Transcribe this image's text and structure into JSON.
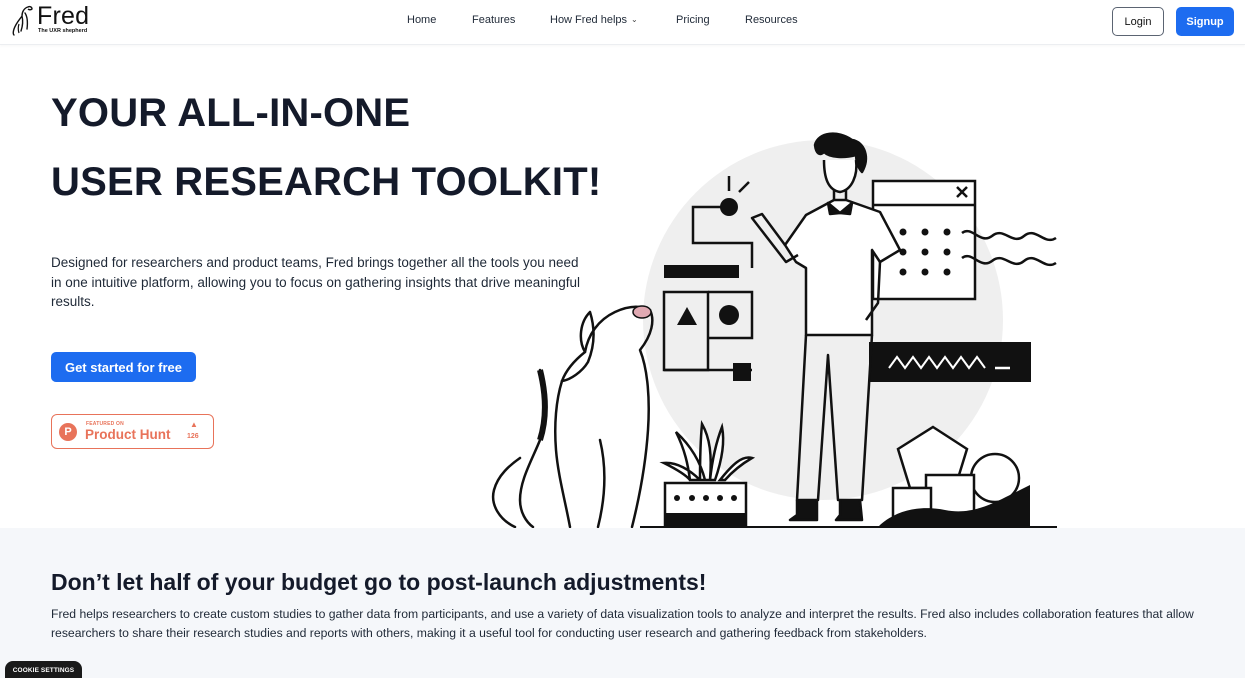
{
  "header": {
    "logo_name": "Fred",
    "logo_tagline": "The UXR shepherd",
    "nav": [
      {
        "label": "Home"
      },
      {
        "label": "Features"
      },
      {
        "label": "How Fred helps"
      },
      {
        "label": "Pricing"
      },
      {
        "label": "Resources"
      }
    ],
    "login_label": "Login",
    "signup_label": "Signup"
  },
  "hero": {
    "title_line1": "YOUR ALL-IN-ONE",
    "title_line2": "USER RESEARCH TOOLKIT!",
    "description": "Designed for researchers and product teams, Fred brings together all the tools you need in one intuitive platform, allowing you to focus on gathering insights that drive meaningful results.",
    "cta_label": "Get started for free",
    "product_hunt": {
      "small_text": "FEATURED ON",
      "name": "Product Hunt",
      "count": "126",
      "icon_letter": "P"
    }
  },
  "section2": {
    "title": "Don’t let half of your budget go to post-launch adjustments!",
    "body": "Fred helps researchers to create custom studies to gather data from participants, and use a variety of data visualization tools to analyze and interpret the results. Fred also includes collaboration features that allow researchers to share their research studies and reports with others, making it a useful tool for conducting user research and gathering feedback from stakeholders."
  },
  "cookie_label": "COOKIE SETTINGS",
  "colors": {
    "accent": "#1d6cf0",
    "product_hunt": "#e8735a",
    "section_bg": "#f5f7fa"
  }
}
